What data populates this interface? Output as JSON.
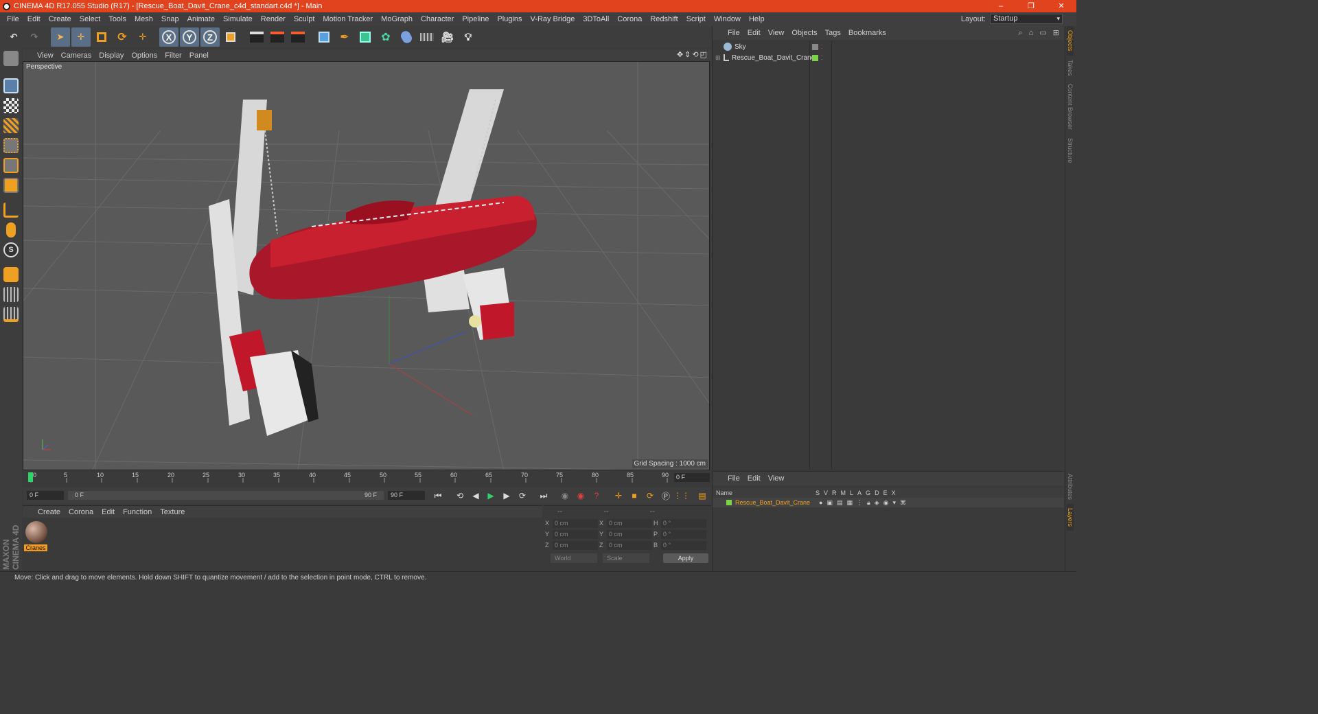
{
  "window": {
    "title": "CINEMA 4D R17.055 Studio (R17) - [Rescue_Boat_Davit_Crane_c4d_standart.c4d *] - Main",
    "minimize": "–",
    "maximize": "❐",
    "close": "✕"
  },
  "menubar": {
    "items": [
      "File",
      "Edit",
      "Create",
      "Select",
      "Tools",
      "Mesh",
      "Snap",
      "Animate",
      "Simulate",
      "Render",
      "Sculpt",
      "Motion Tracker",
      "MoGraph",
      "Character",
      "Pipeline",
      "Plugins",
      "V-Ray Bridge",
      "3DToAll",
      "Corona",
      "Redshift",
      "Script",
      "Window",
      "Help"
    ],
    "layout_label": "Layout:",
    "layout_value": "Startup"
  },
  "toolbar": {
    "axis_x": "X",
    "axis_y": "Y",
    "axis_z": "Z"
  },
  "viewport": {
    "menu": [
      "View",
      "Cameras",
      "Display",
      "Options",
      "Filter",
      "Panel"
    ],
    "camera_label": "Perspective",
    "grid_spacing": "Grid Spacing : 1000 cm"
  },
  "timeline": {
    "ticks": [
      "0",
      "5",
      "10",
      "15",
      "20",
      "25",
      "30",
      "35",
      "40",
      "45",
      "50",
      "55",
      "60",
      "65",
      "70",
      "75",
      "80",
      "85",
      "90"
    ],
    "current_frame": "0 F"
  },
  "transport": {
    "start_frame": "0 F",
    "range_start": "0 F",
    "range_end": "90 F",
    "end_frame": "90 F"
  },
  "material_manager": {
    "menu": [
      "Create",
      "Corona",
      "Edit",
      "Function",
      "Texture"
    ],
    "material_name": "Cranes"
  },
  "coordinates": {
    "header": [
      "--",
      "--",
      "--"
    ],
    "rows": [
      {
        "a1": "X",
        "v1": "0 cm",
        "a2": "X",
        "v2": "0 cm",
        "a3": "H",
        "v3": "0 °"
      },
      {
        "a1": "Y",
        "v1": "0 cm",
        "a2": "Y",
        "v2": "0 cm",
        "a3": "P",
        "v3": "0 °"
      },
      {
        "a1": "Z",
        "v1": "0 cm",
        "a2": "Z",
        "v2": "0 cm",
        "a3": "B",
        "v3": "0 °"
      }
    ],
    "mode": "World",
    "type": "Scale",
    "apply": "Apply"
  },
  "object_manager": {
    "menu": [
      "File",
      "Edit",
      "View",
      "Objects",
      "Tags",
      "Bookmarks"
    ],
    "objects": [
      {
        "name": "Sky"
      },
      {
        "name": "Rescue_Boat_Davit_Crane"
      }
    ]
  },
  "layer_manager": {
    "menu": [
      "File",
      "Edit",
      "View"
    ],
    "columns": [
      "Name",
      "S",
      "V",
      "R",
      "M",
      "L",
      "A",
      "G",
      "D",
      "E",
      "X"
    ],
    "layers": [
      {
        "name": "Rescue_Boat_Davit_Crane",
        "color": "#7cd34a"
      }
    ]
  },
  "side_tabs": [
    "Objects",
    "Takes",
    "Content Browser",
    "Structure"
  ],
  "side_tabs_bottom": [
    "Attributes",
    "Layers"
  ],
  "brand": "MAXON CINEMA 4D",
  "status": "Move: Click and drag to move elements. Hold down SHIFT to quantize movement / add to the selection in point mode, CTRL to remove."
}
